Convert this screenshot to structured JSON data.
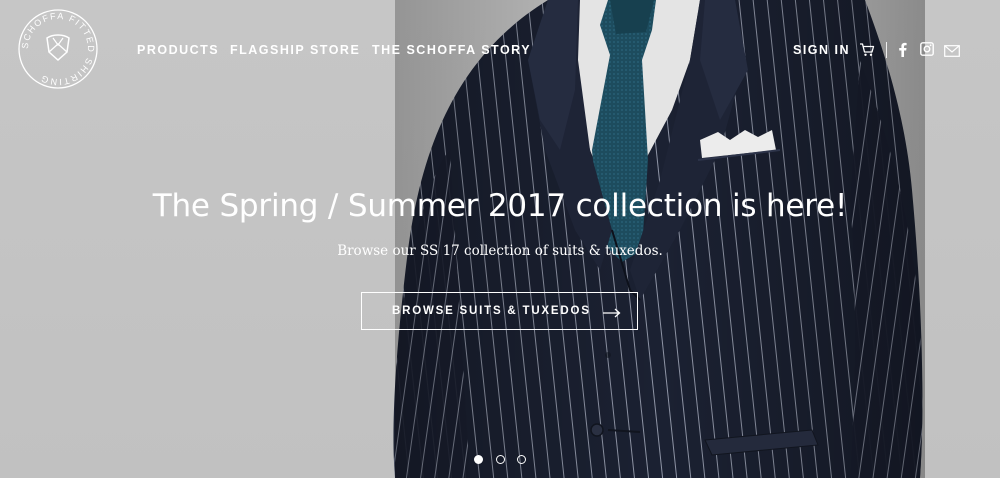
{
  "brand": {
    "logo_text": "SCHOFFA FITTED SHIRTING"
  },
  "nav": {
    "items": [
      {
        "label": "PRODUCTS"
      },
      {
        "label": "FLAGSHIP STORE"
      },
      {
        "label": "THE SCHOFFA STORY"
      }
    ],
    "sign_in": "SIGN IN",
    "icons": [
      "cart-icon",
      "facebook-icon",
      "instagram-icon",
      "mail-icon"
    ]
  },
  "hero": {
    "title": "The Spring / Summer 2017 collection is here!",
    "subtitle": "Browse our SS 17 collection of suits & tuxedos.",
    "cta_label": "BROWSE SUITS & TUXEDOS",
    "cta_icon": "arrow-right-icon"
  },
  "carousel": {
    "slides": 3,
    "active_index": 0
  },
  "colors": {
    "background": "#c4c4c4",
    "suit": "#1c2233",
    "tie": "#1d4c5e",
    "shirt": "#e6e6e6",
    "text": "#ffffff"
  }
}
